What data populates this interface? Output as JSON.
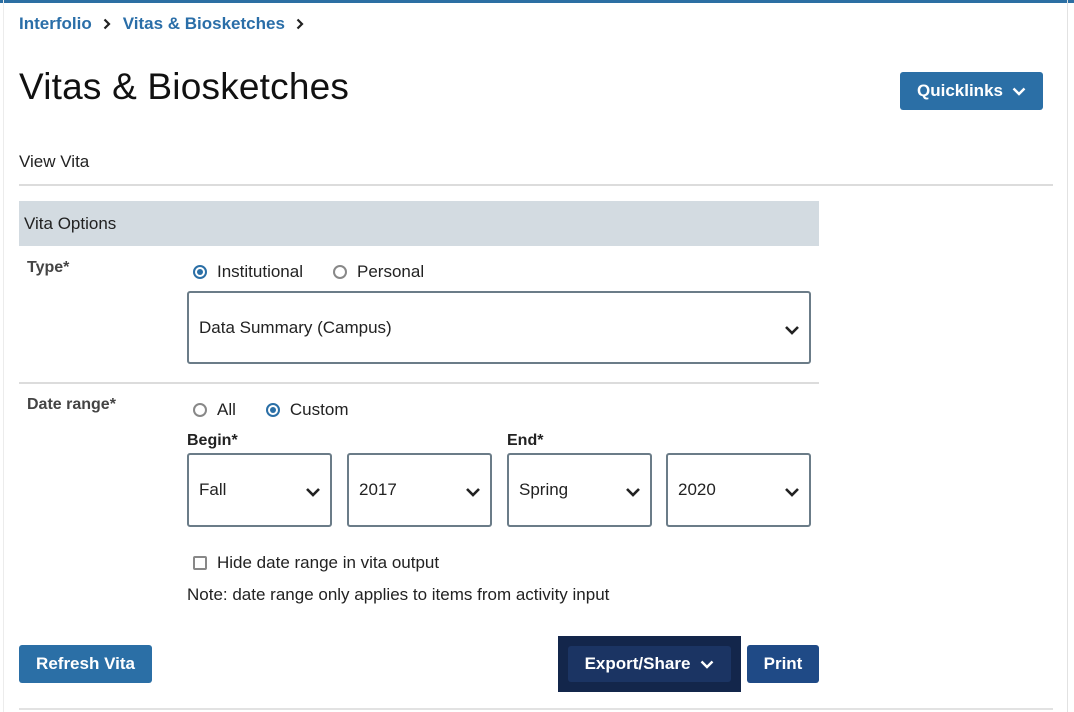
{
  "breadcrumb": {
    "items": [
      "Interfolio",
      "Vitas & Biosketches"
    ]
  },
  "page": {
    "title": "Vitas & Biosketches",
    "quicklinks_label": "Quicklinks",
    "subtitle": "View Vita"
  },
  "vita_options": {
    "header": "Vita Options",
    "type": {
      "label": "Type*",
      "options": [
        "Institutional",
        "Personal"
      ],
      "selected": "Institutional",
      "template_value": "Data Summary (Campus)"
    },
    "date_range": {
      "label": "Date range*",
      "options": [
        "All",
        "Custom"
      ],
      "selected": "Custom",
      "begin_label": "Begin*",
      "end_label": "End*",
      "begin_term": "Fall",
      "begin_year": "2017",
      "end_term": "Spring",
      "end_year": "2020",
      "hide_label": "Hide date range in vita output",
      "hide_checked": false,
      "note": "Note: date range only applies to items from activity input"
    }
  },
  "actions": {
    "refresh_label": "Refresh Vita",
    "export_label": "Export/Share",
    "print_label": "Print"
  },
  "colors": {
    "accent": "#2b6fa6",
    "dark_button": "#1b3463",
    "section_header_bg": "#d3dbe1"
  }
}
